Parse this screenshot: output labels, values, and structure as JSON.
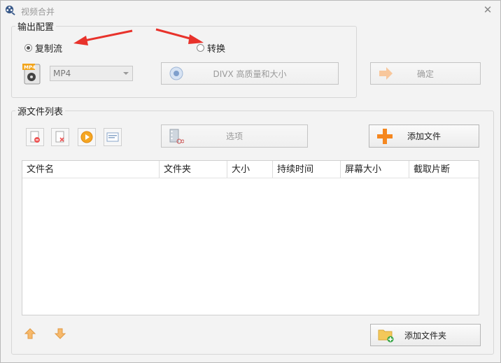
{
  "window": {
    "title": "视频合并",
    "close_glyph": "✕"
  },
  "output_config": {
    "label": "输出配置",
    "radio_copy": {
      "label": "复制流",
      "checked": true
    },
    "radio_convert": {
      "label": "转换",
      "checked": false
    },
    "format_value": "MP4",
    "quality_button": "DIVX 高质量和大小",
    "confirm_button": "确定"
  },
  "source_files": {
    "label": "源文件列表",
    "options_button": "选项",
    "add_file_button": "添加文件",
    "add_folder_button": "添加文件夹",
    "columns": [
      "文件名",
      "文件夹",
      "大小",
      "持续时间",
      "屏幕大小",
      "截取片断"
    ]
  },
  "colors": {
    "accent_red": "#e8322b",
    "orange": "#f59a23"
  }
}
